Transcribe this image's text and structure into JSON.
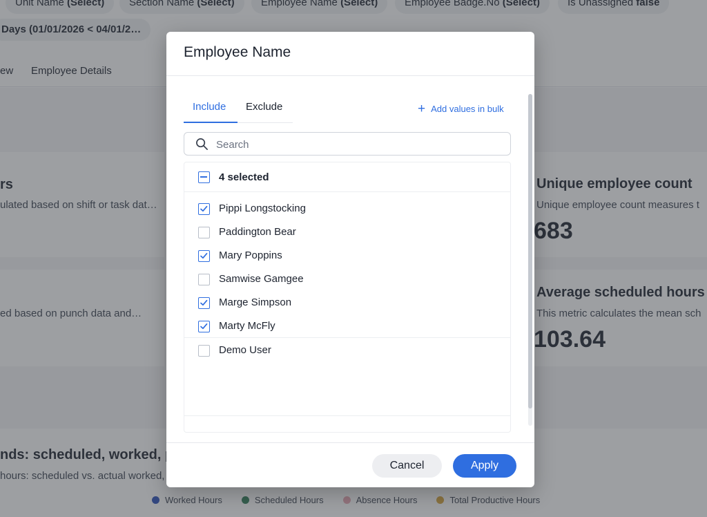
{
  "filters": [
    {
      "name": "Unit Name",
      "value": "(Select)"
    },
    {
      "name": "Section Name",
      "value": "(Select)"
    },
    {
      "name": "Employee Name",
      "value": "(Select)"
    },
    {
      "name": "Employee Badge.No",
      "value": "(Select)"
    },
    {
      "name": "Is Unassigned",
      "value": "false"
    }
  ],
  "date_chip": "Days (01/01/2026 < 04/01/2…",
  "page_tabs": [
    "ew",
    "Employee Details"
  ],
  "cards": {
    "left_top": {
      "title": "rs",
      "desc": "ulated based on shift or task dat…"
    },
    "left_mid": {
      "desc": "ed based on punch data and…"
    },
    "unique": {
      "title": "Unique employee count",
      "desc": "Unique employee count measures t",
      "value": "683"
    },
    "avg": {
      "title": "Average scheduled hours p",
      "desc": "This metric calculates the mean sch",
      "value": "103.64"
    },
    "trends": {
      "title": "nds: scheduled, worked, pro",
      "desc": "hours: scheduled vs. actual worked,"
    }
  },
  "legend": [
    {
      "label": "Worked Hours",
      "color": "#2a4fb8"
    },
    {
      "label": "Scheduled Hours",
      "color": "#2f7d57"
    },
    {
      "label": "Absence Hours",
      "color": "#e9a7b3"
    },
    {
      "label": "Total Productive Hours",
      "color": "#d7a43a"
    }
  ],
  "modal": {
    "title": "Employee Name",
    "tabs": {
      "include": "Include",
      "exclude": "Exclude"
    },
    "bulk": "Add values in bulk",
    "search_placeholder": "Search",
    "selected_label": "4 selected",
    "items": [
      {
        "label": "Pippi Longstocking",
        "checked": true
      },
      {
        "label": "Paddington Bear",
        "checked": false
      },
      {
        "label": "Mary Poppins",
        "checked": true
      },
      {
        "label": "Samwise Gamgee",
        "checked": false
      },
      {
        "label": "Marge Simpson",
        "checked": true
      },
      {
        "label": "Marty McFly",
        "checked": true
      },
      {
        "label": "Demo User",
        "checked": false
      }
    ],
    "cancel": "Cancel",
    "apply": "Apply"
  }
}
